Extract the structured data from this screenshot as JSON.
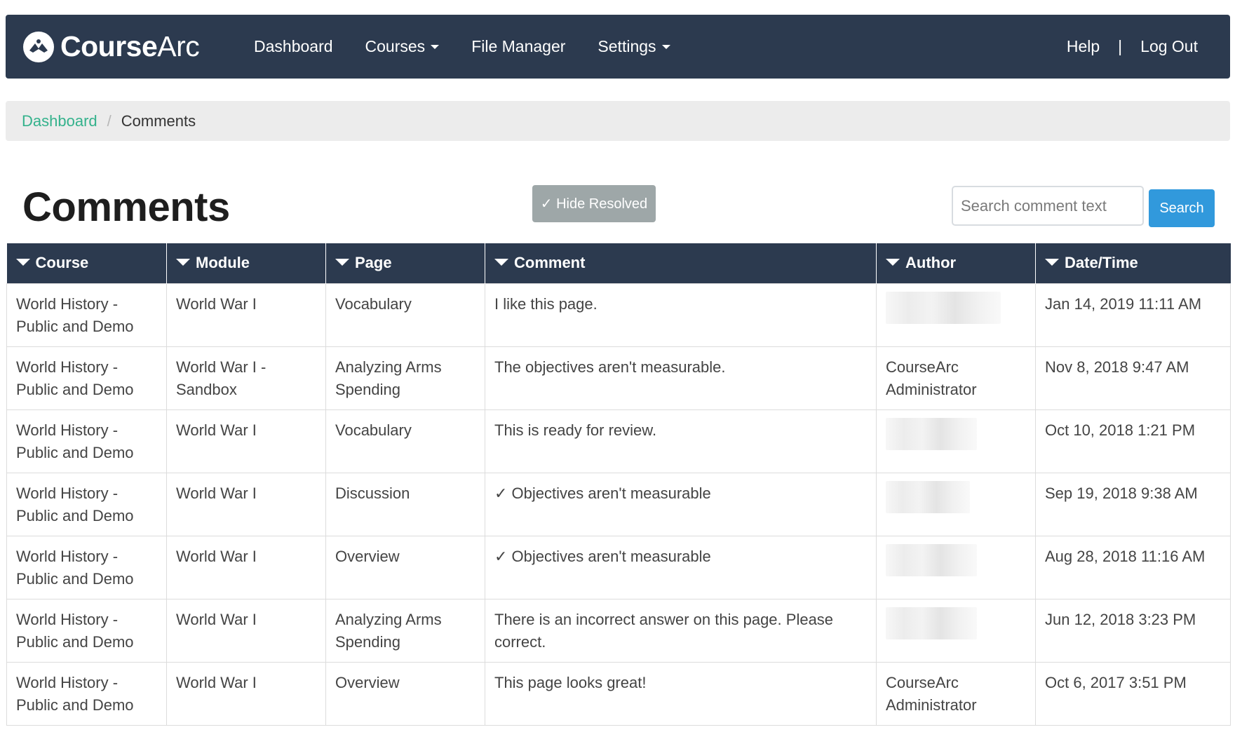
{
  "navbar": {
    "brand_bold": "Course",
    "brand_light": "Arc",
    "items": [
      {
        "label": "Dashboard",
        "dropdown": false
      },
      {
        "label": "Courses",
        "dropdown": true
      },
      {
        "label": "File Manager",
        "dropdown": false
      },
      {
        "label": "Settings",
        "dropdown": true
      }
    ],
    "help_label": "Help",
    "separator": "|",
    "logout_label": "Log Out"
  },
  "breadcrumb": {
    "parent": "Dashboard",
    "separator": "/",
    "current": "Comments"
  },
  "page": {
    "title": "Comments",
    "hide_resolved_label": "✓ Hide Resolved",
    "search_placeholder": "Search comment text",
    "search_button": "Search"
  },
  "table": {
    "columns": [
      "Course",
      "Module",
      "Page",
      "Comment",
      "Author",
      "Date/Time"
    ],
    "rows": [
      {
        "course": "World History - Public and Demo",
        "module": "World War I",
        "page": "Vocabulary",
        "comment": "I like this page.",
        "author": "",
        "datetime": "Jan 14, 2019 11:11 AM"
      },
      {
        "course": "World History - Public and Demo",
        "module": "World War I - Sandbox",
        "page": "Analyzing Arms Spending",
        "comment": "The objectives aren't measurable.",
        "author": "CourseArc Administrator",
        "datetime": "Nov 8, 2018 9:47 AM"
      },
      {
        "course": "World History - Public and Demo",
        "module": "World War I",
        "page": "Vocabulary",
        "comment": "This is ready for review.",
        "author": "",
        "datetime": "Oct 10, 2018 1:21 PM"
      },
      {
        "course": "World History - Public and Demo",
        "module": "World War I",
        "page": "Discussion",
        "comment": "✓ Objectives aren't measurable",
        "author": "",
        "datetime": "Sep 19, 2018 9:38 AM"
      },
      {
        "course": "World History - Public and Demo",
        "module": "World War I",
        "page": "Overview",
        "comment": "✓ Objectives aren't measurable",
        "author": "",
        "datetime": "Aug 28, 2018 11:16 AM"
      },
      {
        "course": "World History - Public and Demo",
        "module": "World War I",
        "page": "Analyzing Arms Spending",
        "comment": "There is an incorrect answer on this page. Please correct.",
        "author": "",
        "datetime": "Jun 12, 2018 3:23 PM"
      },
      {
        "course": "World History - Public and Demo",
        "module": "World War I",
        "page": "Overview",
        "comment": "This page looks great!",
        "author": "CourseArc Administrator",
        "datetime": "Oct 6, 2017 3:51 PM"
      }
    ]
  },
  "colors": {
    "navbar_bg": "#2c3a4f",
    "link_green": "#34b28c",
    "search_blue": "#3199dc",
    "hide_resolved_gray": "#9ea7a8"
  },
  "icons": {
    "brand": "coursearc-logo-icon",
    "dropdown": "caret-down-icon",
    "sort": "sort-caret-icon"
  }
}
